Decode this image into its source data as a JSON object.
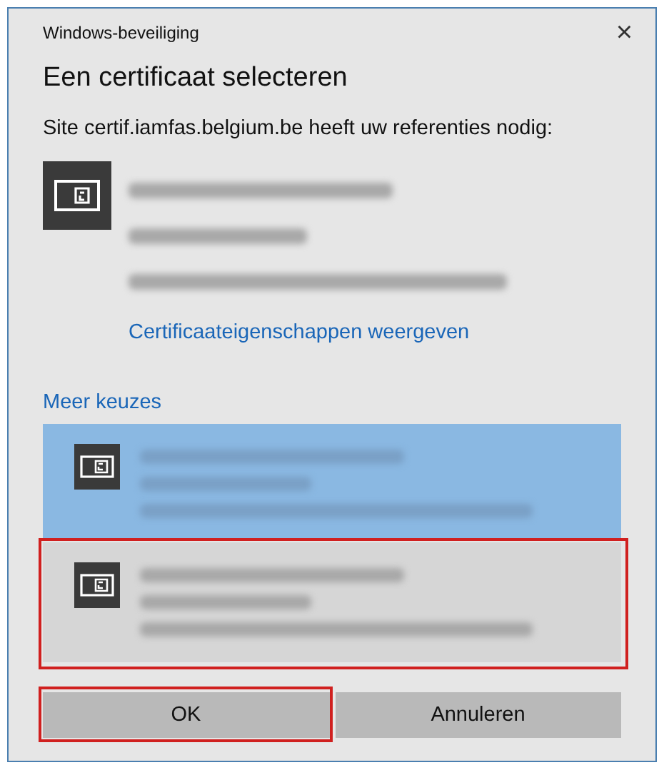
{
  "window": {
    "title": "Windows-beveiliging",
    "close": "×"
  },
  "heading": "Een certificaat selecteren",
  "message": "Site certif.iamfas.belgium.be heeft uw referenties nodig:",
  "current_certificate": {
    "link": "Certificaateigenschappen weergeven"
  },
  "more_choices": {
    "label": "Meer keuzes",
    "options": [
      {
        "selected": true,
        "annotated": false
      },
      {
        "selected": false,
        "annotated": true
      }
    ]
  },
  "buttons": [
    {
      "label": "OK",
      "annotated": true
    },
    {
      "label": "Annuleren",
      "annotated": false
    }
  ]
}
